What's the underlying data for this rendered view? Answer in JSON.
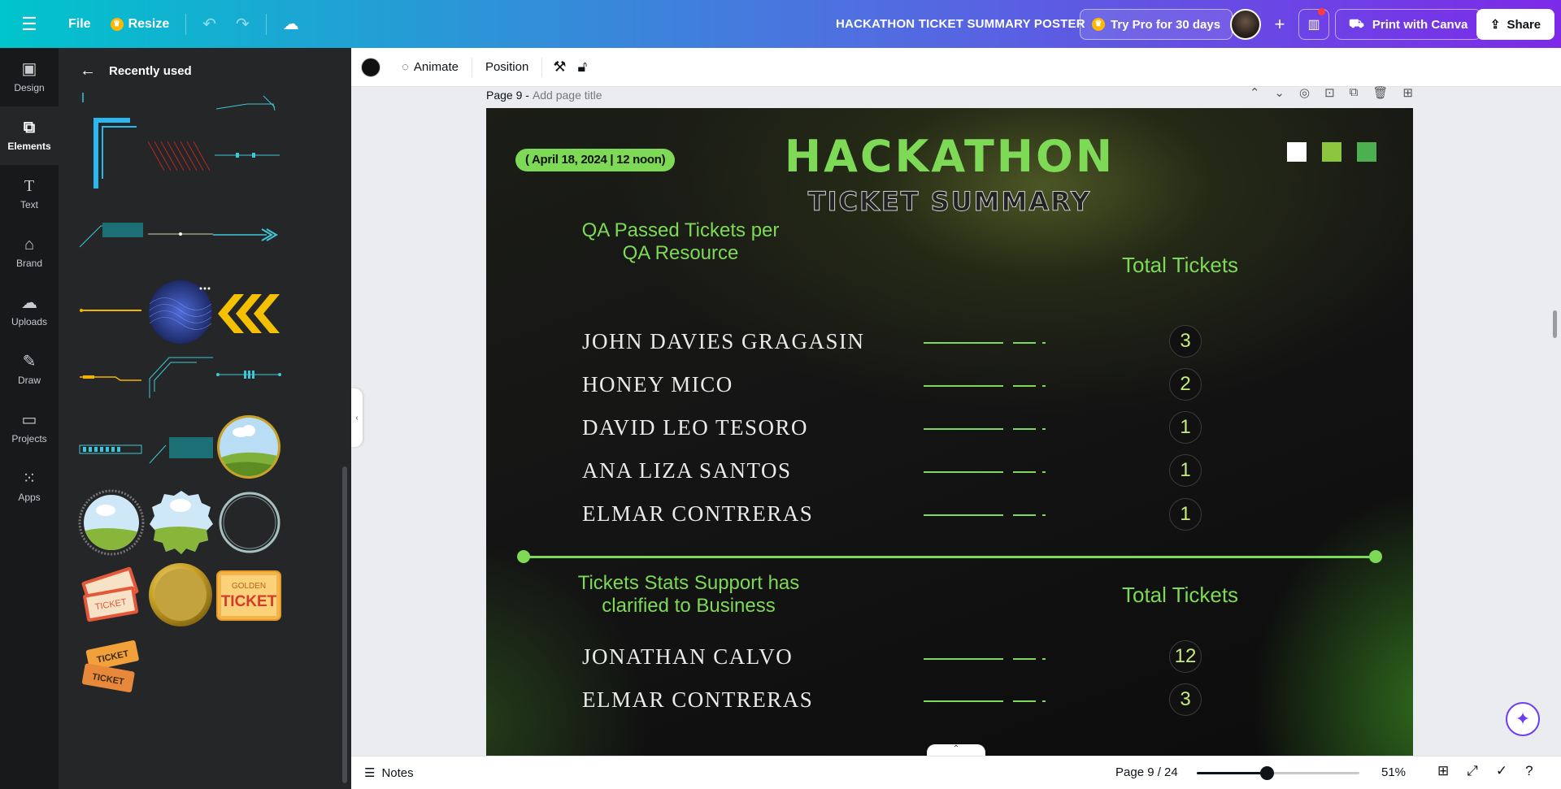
{
  "topbar": {
    "file_label": "File",
    "resize_label": "Resize",
    "doc_title": "HACKATHON TICKET SUMMARY POSTER",
    "pro_label": "Try Pro for 30 days",
    "print_label": "Print with Canva",
    "share_label": "Share"
  },
  "rail": [
    {
      "label": "Design",
      "icon": "design-icon"
    },
    {
      "label": "Elements",
      "icon": "elements-icon"
    },
    {
      "label": "Text",
      "icon": "text-icon"
    },
    {
      "label": "Brand",
      "icon": "brand-icon"
    },
    {
      "label": "Uploads",
      "icon": "uploads-icon"
    },
    {
      "label": "Draw",
      "icon": "draw-icon"
    },
    {
      "label": "Projects",
      "icon": "projects-icon"
    },
    {
      "label": "Apps",
      "icon": "apps-icon"
    }
  ],
  "panel": {
    "title": "Recently used",
    "ticket_text": "TICKET",
    "golden_top": "GOLDEN",
    "golden_main": "TICKET"
  },
  "toolbar": {
    "animate_label": "Animate",
    "position_label": "Position"
  },
  "page": {
    "page_label": "Page 9 -",
    "page_title_placeholder": "Add page title"
  },
  "poster": {
    "date": "( April 18, 2024 |  12 noon)",
    "title": "HACKATHON",
    "subtitle": "TICKET SUMMARY",
    "section1_heading": "QA Passed Tickets per QA Resource",
    "section1_total_label": "Total Tickets",
    "section1_rows": [
      {
        "name": "JOHN DAVIES GRAGASIN",
        "value": "3"
      },
      {
        "name": "HONEY MICO",
        "value": "2"
      },
      {
        "name": "DAVID LEO TESORO",
        "value": "1"
      },
      {
        "name": "ANA LIZA SANTOS",
        "value": "1"
      },
      {
        "name": "ELMAR CONTRERAS",
        "value": "1"
      }
    ],
    "section2_heading": "Tickets Stats Support has clarified to Business",
    "section2_total_label": "Total Tickets",
    "section2_rows": [
      {
        "name": "JONATHAN CALVO",
        "value": "12"
      },
      {
        "name": "ELMAR CONTRERAS",
        "value": "3"
      }
    ],
    "colors": {
      "accent": "#7ed957",
      "square1": "#ffffff",
      "square2": "#8cc63f",
      "square3": "#4caf50"
    }
  },
  "bottombar": {
    "notes_label": "Notes",
    "page_count": "Page 9 / 24",
    "zoom_label": "51%",
    "zoom_fraction": 0.51
  }
}
